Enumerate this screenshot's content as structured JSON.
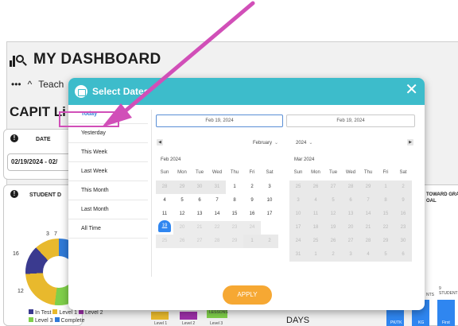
{
  "dashboard": {
    "title": "MY DASHBOARD",
    "crumb_label": "Teach",
    "section_title": "CAPIT Li",
    "date_panel_label": "DATE",
    "date_value": "02/19/2024 - 02/",
    "student_panel_label": "STUDENT D",
    "donut_labels": [
      "3",
      "7",
      "16",
      "12"
    ],
    "legend": [
      "In Test",
      "Level 1",
      "Level 2",
      "Level 3",
      "Complete"
    ],
    "right_panel_label": "TOWARD GRA OAL",
    "days_label": "DAYS",
    "mini_labels": [
      "Level 1",
      "Level 2",
      "Level 3",
      "LESSONS",
      "PK/TK",
      "KG",
      "First",
      "NTS",
      "9 STUDENT"
    ]
  },
  "modal": {
    "title": "Select Dates",
    "close_icon": "✕",
    "apply_label": "APPLY",
    "quick_ranges": [
      "Today",
      "Yesterday",
      "This Week",
      "Last Week",
      "This Month",
      "Last Month",
      "All Time"
    ],
    "active_range": "Today",
    "start_date": "Feb 19, 2024",
    "end_date": "Feb 19, 2024",
    "month_select": "February",
    "year_select": "2024",
    "weekdays": [
      "Sun",
      "Mon",
      "Tue",
      "Wed",
      "Thu",
      "Fri",
      "Sat"
    ],
    "left_calendar": {
      "caption": "Feb 2024",
      "weeks": [
        [
          "28",
          "29",
          "30",
          "31",
          "1",
          "2",
          "3"
        ],
        [
          "4",
          "5",
          "6",
          "7",
          "8",
          "9",
          "10"
        ],
        [
          "11",
          "12",
          "13",
          "14",
          "15",
          "16",
          "17"
        ],
        [
          "18",
          "19",
          "20",
          "21",
          "22",
          "23",
          "24"
        ],
        [
          "25",
          "26",
          "27",
          "28",
          "29",
          "1",
          "2"
        ]
      ],
      "selected": "19"
    },
    "right_calendar": {
      "caption": "Mar 2024",
      "weeks": [
        [
          "25",
          "26",
          "27",
          "28",
          "29",
          "1",
          "2"
        ],
        [
          "3",
          "4",
          "5",
          "6",
          "7",
          "8",
          "9"
        ],
        [
          "10",
          "11",
          "12",
          "13",
          "14",
          "15",
          "16"
        ],
        [
          "17",
          "18",
          "19",
          "20",
          "21",
          "22",
          "23"
        ],
        [
          "24",
          "25",
          "26",
          "27",
          "28",
          "29",
          "30"
        ],
        [
          "31",
          "1",
          "2",
          "3",
          "4",
          "5",
          "6"
        ]
      ]
    }
  },
  "colors": {
    "header": "#3dbccb",
    "apply": "#f6a833",
    "selected_day": "#2f86f0",
    "annotation": "#d14fb8"
  }
}
